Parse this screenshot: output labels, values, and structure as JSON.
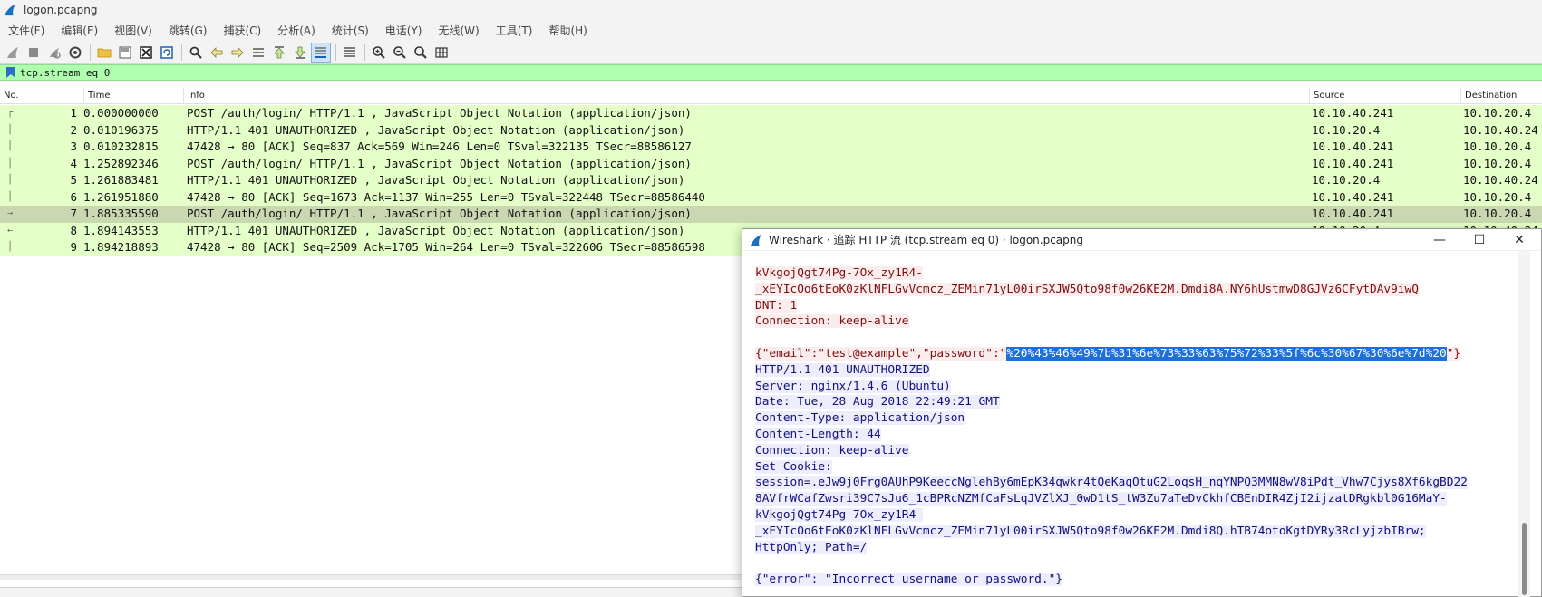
{
  "window": {
    "title": "logon.pcapng"
  },
  "menu": [
    {
      "label": "文件(F)"
    },
    {
      "label": "编辑(E)"
    },
    {
      "label": "视图(V)"
    },
    {
      "label": "跳转(G)"
    },
    {
      "label": "捕获(C)"
    },
    {
      "label": "分析(A)"
    },
    {
      "label": "统计(S)"
    },
    {
      "label": "电话(Y)"
    },
    {
      "label": "无线(W)"
    },
    {
      "label": "工具(T)"
    },
    {
      "label": "帮助(H)"
    }
  ],
  "toolbar": {
    "icons": [
      "shark-fin-start-icon",
      "stop-icon",
      "restart-icon",
      "capture-options-icon",
      "open-folder-icon",
      "save-file-icon",
      "close-file-icon",
      "reload-icon",
      "find-icon",
      "go-back-icon",
      "go-forward-icon",
      "go-to-packet-icon",
      "go-first-icon",
      "go-last-icon",
      "auto-scroll-icon",
      "colorize-icon",
      "zoom-in-icon",
      "zoom-out-icon",
      "zoom-normal-icon",
      "resize-columns-icon"
    ]
  },
  "filter": {
    "value": "tcp.stream eq 0",
    "bar_color": "#afffaf"
  },
  "packet_list": {
    "columns": [
      "No.",
      "Time",
      "Info",
      "Source",
      "Destination"
    ],
    "rows": [
      {
        "no": "1",
        "time": "0.000000000",
        "info": "POST /auth/login/ HTTP/1.1 , JavaScript Object Notation (application/json)",
        "src": "10.10.40.241",
        "dst": "10.10.20.4"
      },
      {
        "no": "2",
        "time": "0.010196375",
        "info": "HTTP/1.1 401 UNAUTHORIZED , JavaScript Object Notation (application/json)",
        "src": "10.10.20.4",
        "dst": "10.10.40.24"
      },
      {
        "no": "3",
        "time": "0.010232815",
        "info": "47428 → 80 [ACK] Seq=837 Ack=569 Win=246 Len=0 TSval=322135 TSecr=88586127",
        "src": "10.10.40.241",
        "dst": "10.10.20.4"
      },
      {
        "no": "4",
        "time": "1.252892346",
        "info": "POST /auth/login/ HTTP/1.1 , JavaScript Object Notation (application/json)",
        "src": "10.10.40.241",
        "dst": "10.10.20.4"
      },
      {
        "no": "5",
        "time": "1.261883481",
        "info": "HTTP/1.1 401 UNAUTHORIZED , JavaScript Object Notation (application/json)",
        "src": "10.10.20.4",
        "dst": "10.10.40.24"
      },
      {
        "no": "6",
        "time": "1.261951880",
        "info": "47428 → 80 [ACK] Seq=1673 Ack=1137 Win=255 Len=0 TSval=322448 TSecr=88586440",
        "src": "10.10.40.241",
        "dst": "10.10.20.4"
      },
      {
        "no": "7",
        "time": "1.885335590",
        "info": "POST /auth/login/ HTTP/1.1 , JavaScript Object Notation (application/json)",
        "src": "10.10.40.241",
        "dst": "10.10.20.4"
      },
      {
        "no": "8",
        "time": "1.894143553",
        "info": "HTTP/1.1 401 UNAUTHORIZED , JavaScript Object Notation (application/json)",
        "src": "10.10.20.4",
        "dst": "10.10.40.24"
      },
      {
        "no": "9",
        "time": "1.894218893",
        "info": "47428 → 80 [ACK] Seq=2509 Ack=1705 Win=264 Len=0 TSval=322606 TSecr=88586598",
        "src": "10.10.40.241",
        "dst": "10.10.20.4"
      }
    ],
    "row_color": "#e4ffc7",
    "selected_row": "7"
  },
  "dialog": {
    "title": "Wireshark · 追踪 HTTP 流 (tcp.stream eq 0) · logon.pcapng",
    "minimize": "—",
    "maximize": "☐",
    "close": "✕",
    "client_color": "#7e0f0f",
    "server_color": "#11117d",
    "lines": [
      {
        "who": "client",
        "text": "kVkgojQgt74Pg-7Ox_zy1R4-"
      },
      {
        "who": "client",
        "text": "_xEYIcOo6tEoK0zKlNFLGvVcmcz_ZEMin71yL00irSXJW5Qto98f0w26KE2M.Dmdi8A.NY6hUstmwD8GJVz6CFytDAv9iwQ"
      },
      {
        "who": "client",
        "text": "DNT: 1"
      },
      {
        "who": "client",
        "text": "Connection: keep-alive"
      },
      {
        "who": "blank",
        "text": ""
      },
      {
        "who": "client-json",
        "pre": "{\"email\":\"test@example\",\"password\":\"",
        "sel": "%20%43%46%49%7b%31%6e%73%33%63%75%72%33%5f%6c%30%67%30%6e%7d%20",
        "post": "\"}"
      },
      {
        "who": "server",
        "text": "HTTP/1.1 401 UNAUTHORIZED"
      },
      {
        "who": "server",
        "text": "Server: nginx/1.4.6 (Ubuntu)"
      },
      {
        "who": "server",
        "text": "Date: Tue, 28 Aug 2018 22:49:21 GMT"
      },
      {
        "who": "server",
        "text": "Content-Type: application/json"
      },
      {
        "who": "server",
        "text": "Content-Length: 44"
      },
      {
        "who": "server",
        "text": "Connection: keep-alive"
      },
      {
        "who": "server",
        "text": "Set-Cookie:"
      },
      {
        "who": "server",
        "text": "session=.eJw9j0Frg0AUhP9KeeccNglehBy6mEpK34qwkr4tQeKaqOtuG2LoqsH_nqYNPQ3MMN8wV8iPdt_Vhw7Cjys8Xf6kgBD22"
      },
      {
        "who": "server",
        "text": "8AVfrWCafZwsri39C7sJu6_1cBPRcNZMfCaFsLqJVZlXJ_0wD1tS_tW3Zu7aTeDvCkhfCBEnDIR4ZjI2ijzatDRgkbl0G16MaY-"
      },
      {
        "who": "server",
        "text": "kVkgojQgt74Pg-7Ox_zy1R4-"
      },
      {
        "who": "server",
        "text": "_xEYIcOo6tEoK0zKlNFLGvVcmcz_ZEMin71yL00irSXJW5Qto98f0w26KE2M.Dmdi8Q.hTB74otoKgtDYRy3RcLyjzbIBrw;"
      },
      {
        "who": "server",
        "text": "HttpOnly; Path=/"
      },
      {
        "who": "blank",
        "text": ""
      },
      {
        "who": "server",
        "text": "{\"error\": \"Incorrect username or password.\"}"
      }
    ]
  }
}
